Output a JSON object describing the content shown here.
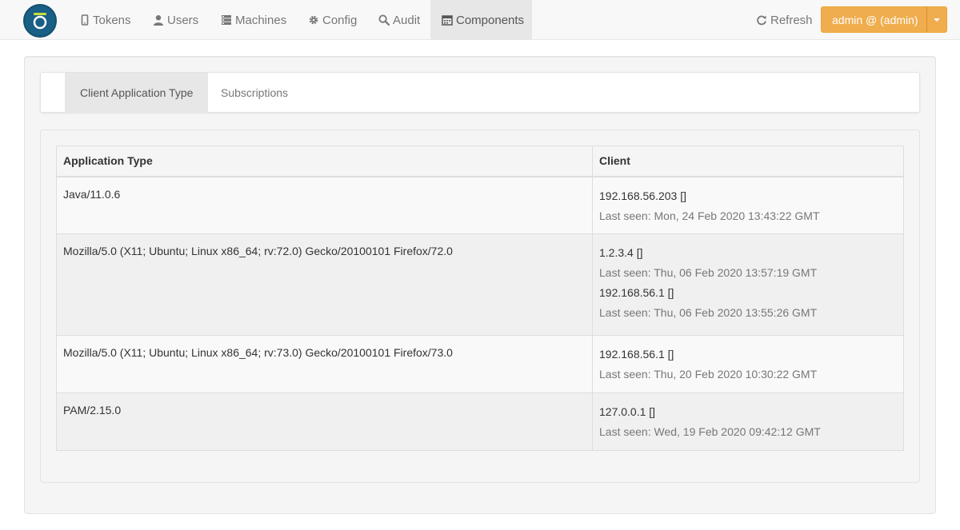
{
  "navbar": {
    "items": [
      {
        "label": "Tokens",
        "icon": "mobile-icon"
      },
      {
        "label": "Users",
        "icon": "user-icon"
      },
      {
        "label": "Machines",
        "icon": "server-icon"
      },
      {
        "label": "Config",
        "icon": "gear-icon"
      },
      {
        "label": "Audit",
        "icon": "search-icon"
      },
      {
        "label": "Components",
        "icon": "calendar-icon"
      }
    ],
    "active": "Components",
    "refresh_label": "Refresh",
    "user_label": "admin @ (admin)"
  },
  "subnav": {
    "tabs": [
      {
        "label": "Client Application Type"
      },
      {
        "label": "Subscriptions"
      }
    ],
    "active": "Client Application Type"
  },
  "table": {
    "headers": [
      "Application Type",
      "Client"
    ],
    "rows": [
      {
        "app_type": "Java/11.0.6",
        "clients": [
          {
            "ip": "192.168.56.203 []",
            "last_seen": "Last seen: Mon, 24 Feb 2020 13:43:22 GMT"
          }
        ]
      },
      {
        "app_type": "Mozilla/5.0 (X11; Ubuntu; Linux x86_64; rv:72.0) Gecko/20100101 Firefox/72.0",
        "clients": [
          {
            "ip": "1.2.3.4 []",
            "last_seen": "Last seen: Thu, 06 Feb 2020 13:57:19 GMT"
          },
          {
            "ip": "192.168.56.1 []",
            "last_seen": "Last seen: Thu, 06 Feb 2020 13:55:26 GMT"
          }
        ]
      },
      {
        "app_type": "Mozilla/5.0 (X11; Ubuntu; Linux x86_64; rv:73.0) Gecko/20100101 Firefox/73.0",
        "clients": [
          {
            "ip": "192.168.56.1 []",
            "last_seen": "Last seen: Thu, 20 Feb 2020 10:30:22 GMT"
          }
        ]
      },
      {
        "app_type": "PAM/2.15.0",
        "clients": [
          {
            "ip": "127.0.0.1 []",
            "last_seen": "Last seen: Wed, 19 Feb 2020 09:42:12 GMT"
          }
        ]
      }
    ]
  },
  "colors": {
    "accent": "#f0ad4e",
    "logo": "#1a5f86",
    "logo_ring": "#c8dc3c"
  }
}
